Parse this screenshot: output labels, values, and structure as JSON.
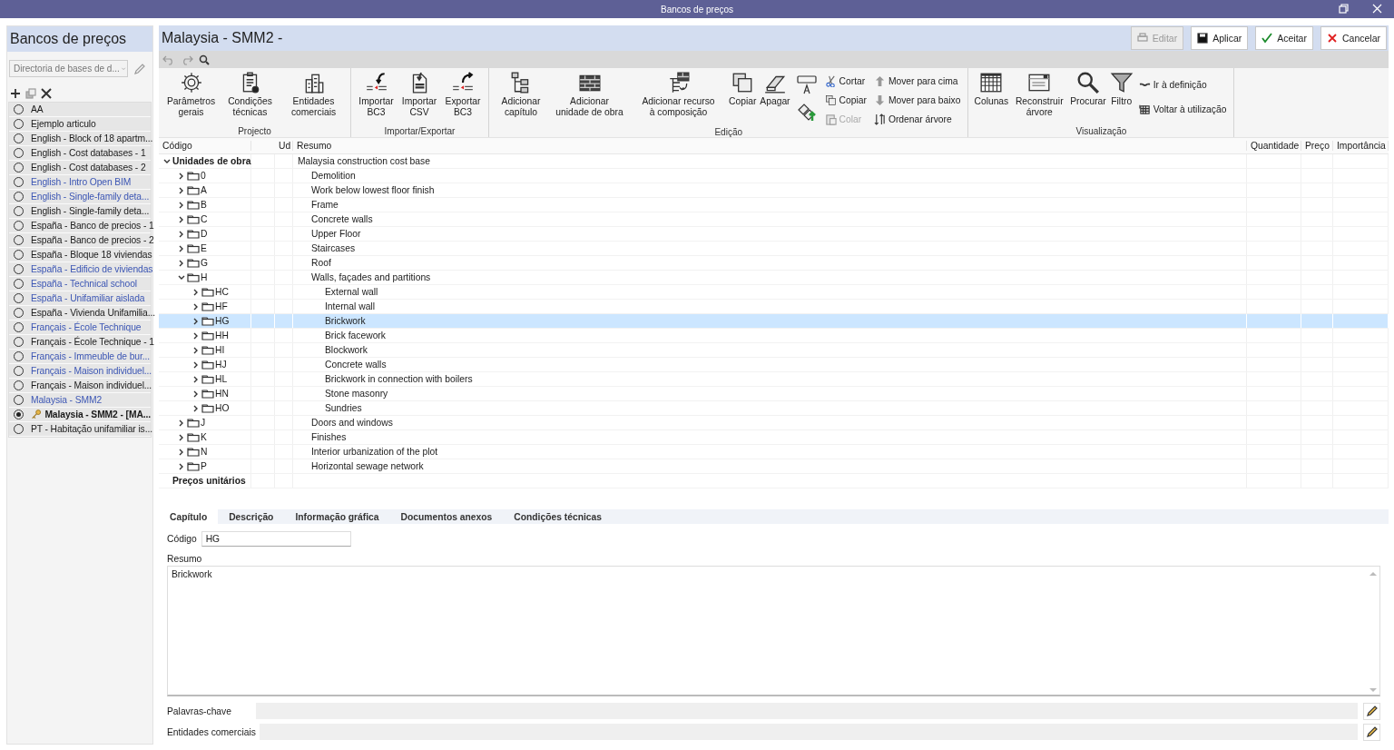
{
  "window": {
    "title": "Bancos de preços"
  },
  "sidebar": {
    "title": "Bancos de preços",
    "directory": {
      "value": "Directoria de bases de d..."
    },
    "items": [
      {
        "label": "AA",
        "selected": false,
        "editing": false,
        "linked": false
      },
      {
        "label": "Ejemplo articulo",
        "selected": false,
        "editing": false,
        "linked": false
      },
      {
        "label": "English - Block of 18 apartm...",
        "selected": false,
        "editing": false,
        "linked": false
      },
      {
        "label": "English - Cost databases - 1",
        "selected": false,
        "editing": false,
        "linked": false
      },
      {
        "label": "English - Cost databases - 2",
        "selected": false,
        "editing": false,
        "linked": false
      },
      {
        "label": "English - Intro Open BIM",
        "selected": false,
        "editing": false,
        "linked": true
      },
      {
        "label": "English - Single-family deta...",
        "selected": false,
        "editing": false,
        "linked": true
      },
      {
        "label": "English - Single-family deta...",
        "selected": false,
        "editing": false,
        "linked": false
      },
      {
        "label": "España - Banco de precios - 1",
        "selected": false,
        "editing": false,
        "linked": false
      },
      {
        "label": "España - Banco de precios - 2",
        "selected": false,
        "editing": false,
        "linked": false
      },
      {
        "label": "España - Bloque 18 viviendas",
        "selected": false,
        "editing": false,
        "linked": false
      },
      {
        "label": "España - Edificio de viviendas",
        "selected": false,
        "editing": false,
        "linked": true
      },
      {
        "label": "España - Technical school",
        "selected": false,
        "editing": false,
        "linked": true
      },
      {
        "label": "España - Unifamiliar aislada",
        "selected": false,
        "editing": false,
        "linked": true
      },
      {
        "label": "España - Vivienda Unifamilia...",
        "selected": false,
        "editing": false,
        "linked": false
      },
      {
        "label": "Français - École Technique",
        "selected": false,
        "editing": false,
        "linked": true
      },
      {
        "label": "Français - École Technique - 1",
        "selected": false,
        "editing": false,
        "linked": false
      },
      {
        "label": "Français - Immeuble de bur...",
        "selected": false,
        "editing": false,
        "linked": true
      },
      {
        "label": "Français - Maison individuel...",
        "selected": false,
        "editing": false,
        "linked": true
      },
      {
        "label": "Français - Maison individuel...",
        "selected": false,
        "editing": false,
        "linked": false
      },
      {
        "label": "Malaysia - SMM2",
        "selected": false,
        "editing": false,
        "linked": true
      },
      {
        "label": "Malaysia - SMM2 - [MA...",
        "selected": true,
        "editing": true,
        "linked": false
      },
      {
        "label": "PT - Habitação unifamiliar is...",
        "selected": false,
        "editing": false,
        "linked": false
      }
    ]
  },
  "header": {
    "title": "Malaysia - SMM2 -",
    "buttons": [
      {
        "label": "Editar",
        "kind": "edit",
        "disabled": true
      },
      {
        "label": "Aplicar",
        "kind": "save",
        "disabled": false
      },
      {
        "label": "Aceitar",
        "kind": "accept",
        "disabled": false
      },
      {
        "label": "Cancelar",
        "kind": "cancel",
        "disabled": false
      }
    ]
  },
  "ribbon": {
    "groups": [
      {
        "label": "Projecto",
        "buttons": [
          {
            "label": "Parâmetros gerais",
            "kind": "gear",
            "disabled": false
          },
          {
            "label": "Condições técnicas",
            "kind": "clipboard",
            "disabled": false
          },
          {
            "label": "Entidades comerciais",
            "kind": "buildings",
            "disabled": false
          }
        ]
      },
      {
        "label": "Importar/Exportar",
        "buttons": [
          {
            "label": "Importar BC3",
            "kind": "import",
            "disabled": false
          },
          {
            "label": "Importar CSV",
            "kind": "csv",
            "disabled": false
          },
          {
            "label": "Exportar BC3",
            "kind": "export",
            "disabled": false
          }
        ]
      },
      {
        "label": "Edição",
        "buttons": [
          {
            "label": "Adicionar capítulo",
            "kind": "hierarchy",
            "disabled": false
          },
          {
            "label": "Adicionar unidade de obra",
            "kind": "bricks",
            "disabled": false
          },
          {
            "label": "Adicionar recurso à composição",
            "kind": "resource",
            "disabled": false
          },
          {
            "label": "Copiar",
            "kind": "copy",
            "disabled": false
          },
          {
            "label": "Apagar",
            "kind": "eraser",
            "disabled": false
          }
        ],
        "tools": [
          {
            "kind": "textbox",
            "disabled": false
          },
          {
            "kind": "pricetag",
            "disabled": false
          }
        ],
        "commands": [
          {
            "label": "Cortar",
            "kind": "scissors",
            "disabled": false
          },
          {
            "label": "Copiar",
            "kind": "copy",
            "disabled": false
          },
          {
            "label": "Colar",
            "kind": "paste",
            "disabled": true
          },
          {
            "label": "Mover para cima",
            "kind": "up",
            "disabled": false
          },
          {
            "label": "Mover para baixo",
            "kind": "down",
            "disabled": false
          },
          {
            "label": "Ordenar árvore",
            "kind": "sort",
            "disabled": false
          }
        ]
      },
      {
        "label": "Visualização",
        "buttons": [
          {
            "label": "Colunas",
            "kind": "grid",
            "disabled": false
          },
          {
            "label": "Reconstruir árvore",
            "kind": "window",
            "disabled": false
          },
          {
            "label": "Procurar",
            "kind": "search",
            "disabled": false
          },
          {
            "label": "Filtro",
            "kind": "funnel",
            "disabled": false
          }
        ],
        "commands": [
          {
            "label": "Ir à definição",
            "kind": "link",
            "disabled": false
          },
          {
            "label": "Voltar à utilização",
            "kind": "table",
            "disabled": false
          }
        ]
      }
    ]
  },
  "table": {
    "columns": [
      "Código",
      "Ud",
      "Resumo",
      "Quantidade",
      "Preço",
      "Importância"
    ],
    "rows": [
      {
        "code": "Unidades de obra",
        "summary": "Malaysia construction cost base",
        "kind": "group",
        "expanded": true,
        "selected": false,
        "children": [
          {
            "code": "0",
            "summary": "Demolition",
            "kind": "chapter",
            "expanded": false,
            "selected": false
          },
          {
            "code": "A",
            "summary": "Work below lowest floor finish",
            "kind": "chapter",
            "expanded": false,
            "selected": false
          },
          {
            "code": "B",
            "summary": "Frame",
            "kind": "chapter",
            "expanded": false,
            "selected": false
          },
          {
            "code": "C",
            "summary": "Concrete walls",
            "kind": "chapter",
            "expanded": false,
            "selected": false
          },
          {
            "code": "D",
            "summary": "Upper Floor",
            "kind": "chapter",
            "expanded": false,
            "selected": false
          },
          {
            "code": "E",
            "summary": "Staircases",
            "kind": "chapter",
            "expanded": false,
            "selected": false
          },
          {
            "code": "G",
            "summary": "Roof",
            "kind": "chapter",
            "expanded": false,
            "selected": false
          },
          {
            "code": "H",
            "summary": "Walls, façades and partitions",
            "kind": "chapter",
            "expanded": true,
            "selected": false,
            "children": [
              {
                "code": "HC",
                "summary": "External wall",
                "kind": "chapter",
                "expanded": false,
                "selected": false
              },
              {
                "code": "HF",
                "summary": "Internal wall",
                "kind": "chapter",
                "expanded": false,
                "selected": false
              },
              {
                "code": "HG",
                "summary": "Brickwork",
                "kind": "chapter",
                "expanded": false,
                "selected": true
              },
              {
                "code": "HH",
                "summary": "Brick facework",
                "kind": "chapter",
                "expanded": false,
                "selected": false
              },
              {
                "code": "HI",
                "summary": "Blockwork",
                "kind": "chapter",
                "expanded": false,
                "selected": false
              },
              {
                "code": "HJ",
                "summary": "Concrete walls",
                "kind": "chapter",
                "expanded": false,
                "selected": false
              },
              {
                "code": "HL",
                "summary": "Brickwork in connection with boilers",
                "kind": "chapter",
                "expanded": false,
                "selected": false
              },
              {
                "code": "HN",
                "summary": "Stone masonry",
                "kind": "chapter",
                "expanded": false,
                "selected": false
              },
              {
                "code": "HO",
                "summary": "Sundries",
                "kind": "chapter",
                "expanded": false,
                "selected": false
              }
            ]
          },
          {
            "code": "J",
            "summary": "Doors and windows",
            "kind": "chapter",
            "expanded": false,
            "selected": false
          },
          {
            "code": "K",
            "summary": "Finishes",
            "kind": "chapter",
            "expanded": false,
            "selected": false
          },
          {
            "code": "N",
            "summary": "Interior urbanization of the plot",
            "kind": "chapter",
            "expanded": false,
            "selected": false
          },
          {
            "code": "P",
            "summary": "Horizontal sewage network",
            "kind": "chapter",
            "expanded": false,
            "selected": false
          }
        ]
      },
      {
        "code": "Preços unitários",
        "kind": "group",
        "expanded": false,
        "selected": false
      }
    ]
  },
  "detail": {
    "tabs": [
      {
        "label": "Capítulo",
        "selected": true
      },
      {
        "label": "Descrição",
        "selected": false
      },
      {
        "label": "Informação gráfica",
        "selected": false
      },
      {
        "label": "Documentos anexos",
        "selected": false
      },
      {
        "label": "Condições técnicas",
        "selected": false
      }
    ],
    "code": {
      "label": "Código",
      "value": "HG"
    },
    "summary": {
      "label": "Resumo",
      "value": "Brickwork"
    },
    "keywords": {
      "label": "Palavras-chave"
    },
    "entities": {
      "label": "Entidades comerciais"
    }
  }
}
